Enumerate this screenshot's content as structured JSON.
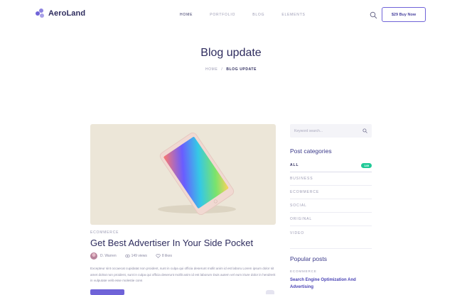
{
  "brand": {
    "name": "AeroLand",
    "accent": "#6f63d8"
  },
  "nav": {
    "items": [
      "HOME",
      "PORTFOLIO",
      "BLOG",
      "ELEMENTS"
    ],
    "active": "HOME",
    "buy_label": "$29 Buy Now"
  },
  "hero": {
    "title": "Blog update",
    "breadcrumb_home": "HOME",
    "breadcrumb_sep": "/",
    "breadcrumb_current": "BLOG UPDATE"
  },
  "post": {
    "category": "ECOMMERCE",
    "title": "Get Best Advertiser In Your Side Pocket",
    "author": "D. Warren",
    "views": "149 views",
    "likes": "8 likes",
    "excerpt": "Excepteur sint occaecat cupidatat non proident, sunt in culpa qui officia deserunt mollit anim id est laboru Lorem ipsum dolor sit amet dolrat non proident, sunt in culpa qui officia deserunt mollit anim id est laborum Duis autem vel eum iriure dolor in hendrerit in vulputate velit esse molestie cons"
  },
  "sidebar": {
    "search_placeholder": "Keyword search...",
    "categories_heading": "Post categories",
    "categories": [
      {
        "label": "ALL",
        "badge": "149"
      },
      {
        "label": "BUSINESS"
      },
      {
        "label": "ECOMMERCE"
      },
      {
        "label": "SOCIAL"
      },
      {
        "label": "ORIGINAL"
      },
      {
        "label": "VIDEO"
      }
    ],
    "popular_heading": "Popular posts",
    "popular": [
      {
        "category": "ECOMMERCE",
        "title": "Search Engine Optimization And Advertising"
      }
    ]
  },
  "colors": {
    "badge": "#20c997",
    "hero_bg": "#f1f0fc"
  }
}
